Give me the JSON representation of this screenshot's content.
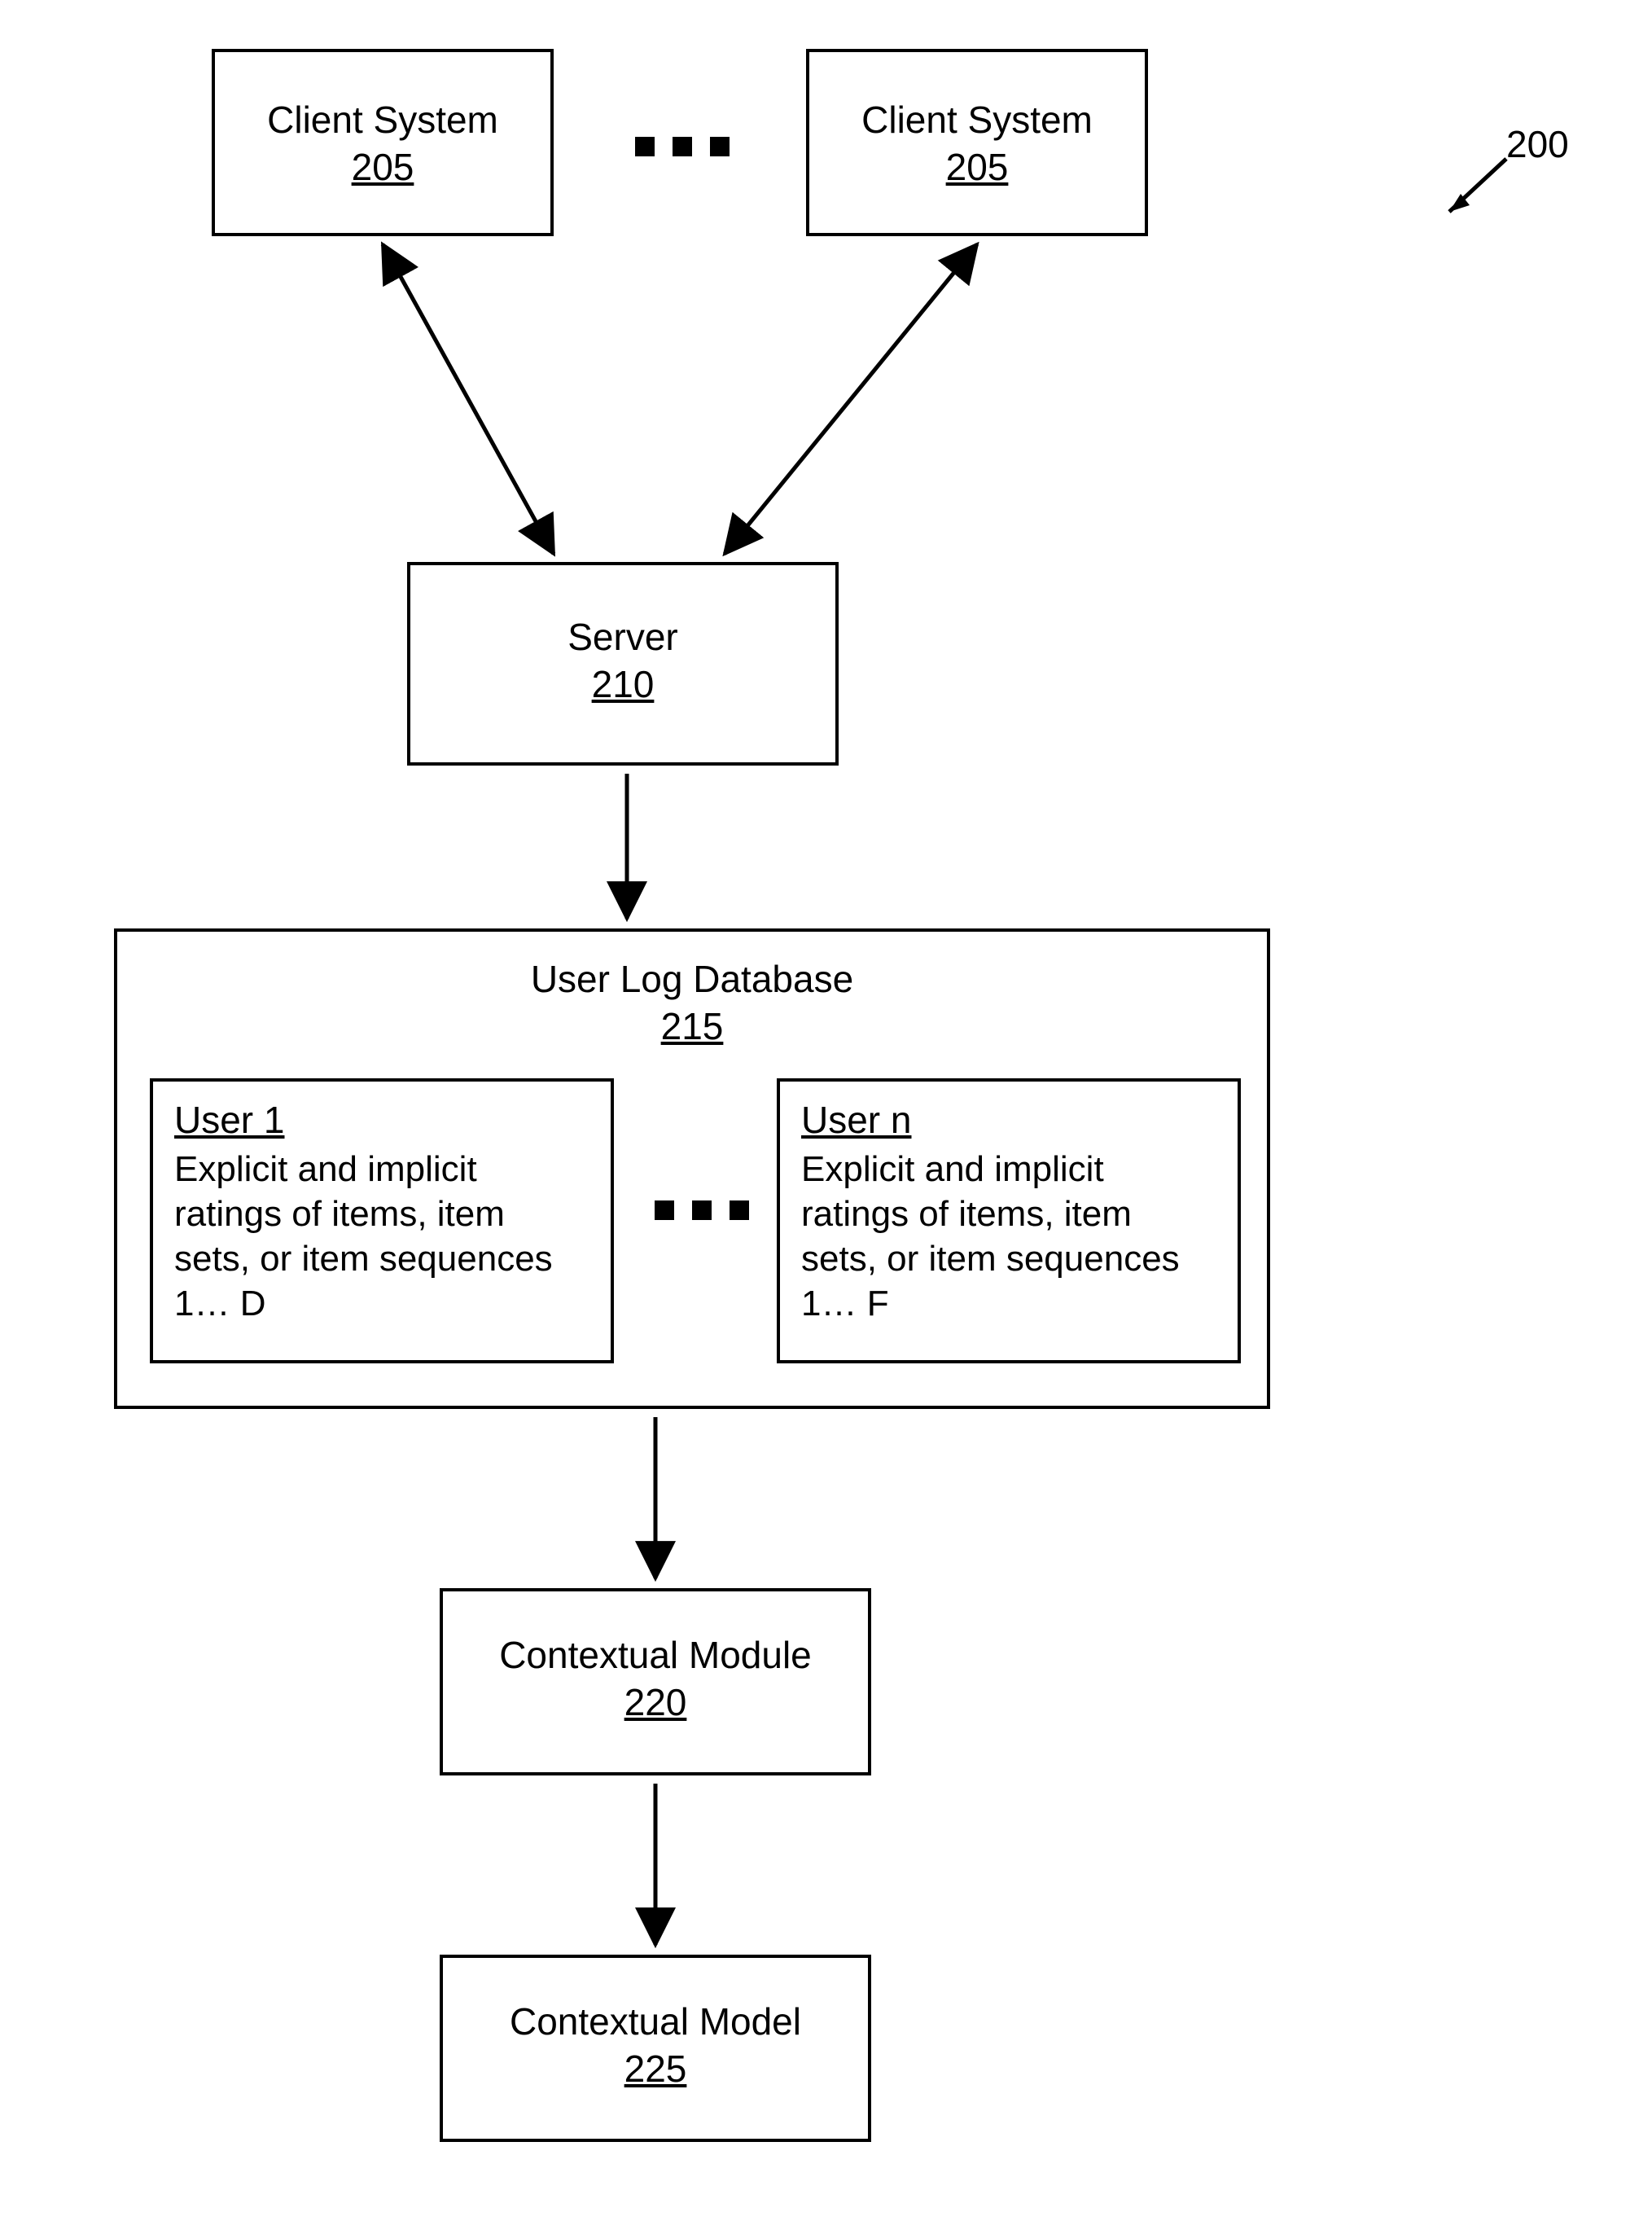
{
  "figure_label": "200",
  "client1": {
    "title": "Client System",
    "ref": "205"
  },
  "client2": {
    "title": "Client System",
    "ref": "205"
  },
  "server": {
    "title": "Server",
    "ref": "210"
  },
  "userlog": {
    "title": "User Log Database",
    "ref": "215"
  },
  "user1": {
    "label": "User 1",
    "desc": "Explicit and implicit ratings of items, item sets, or item sequences 1… D"
  },
  "usern": {
    "label": "User n",
    "desc": "Explicit and implicit ratings of items, item sets, or item sequences 1… F"
  },
  "cmodule": {
    "title": "Contextual Module",
    "ref": "220"
  },
  "cmodel": {
    "title": "Contextual Model",
    "ref": "225"
  }
}
